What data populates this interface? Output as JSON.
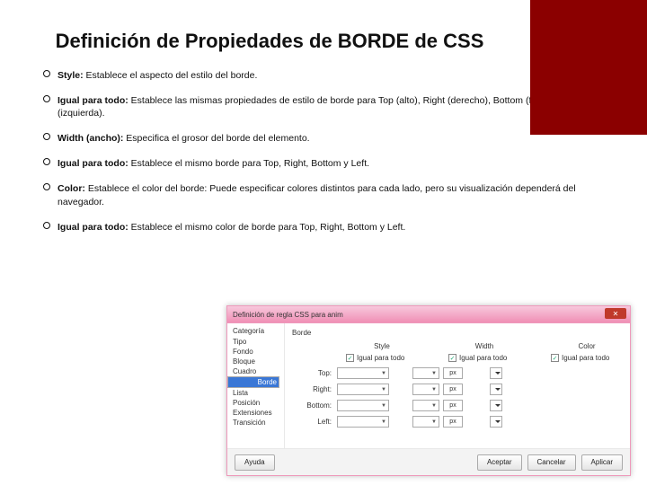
{
  "title": "Definición de Propiedades de BORDE de CSS",
  "bullets": [
    {
      "bold": "Style:",
      "rest": " Establece el aspecto del estilo del borde."
    },
    {
      "bold": "Igual para todo:",
      "rest": " Establece las mismas propiedades de estilo de borde para Top (alto), Right (derecho), Bottom (fondo) y Left (izquierda)."
    },
    {
      "bold": "Width (ancho):",
      "rest": " Especifica el grosor del borde del elemento."
    },
    {
      "bold": "Igual para todo:",
      "rest": " Establece el mismo borde para Top, Right, Bottom y Left."
    },
    {
      "bold": "Color:",
      "rest": " Establece el color del borde: Puede especificar colores distintos para cada lado, pero su visualización dependerá del navegador."
    },
    {
      "bold": "Igual para todo:",
      "rest": " Establece el mismo color de borde para Top, Right, Bottom y Left."
    }
  ],
  "dialog": {
    "title": "Definición de regla CSS para anim",
    "close": "✕",
    "catHeader": "Categoría",
    "categories": [
      "Tipo",
      "Fondo",
      "Bloque",
      "Cuadro",
      "Borde",
      "Lista",
      "Posición",
      "Extensiones",
      "Transición"
    ],
    "selectedIndex": 4,
    "mainHeader": "Borde",
    "columns": {
      "style": "Style",
      "width": "Width",
      "color": "Color"
    },
    "sameLabel": "Igual para todo",
    "unitLabel": "px",
    "rows": [
      "Top:",
      "Right:",
      "Bottom:",
      "Left:"
    ],
    "buttons": {
      "help": "Ayuda",
      "accept": "Aceptar",
      "cancel": "Cancelar",
      "apply": "Aplicar"
    }
  }
}
